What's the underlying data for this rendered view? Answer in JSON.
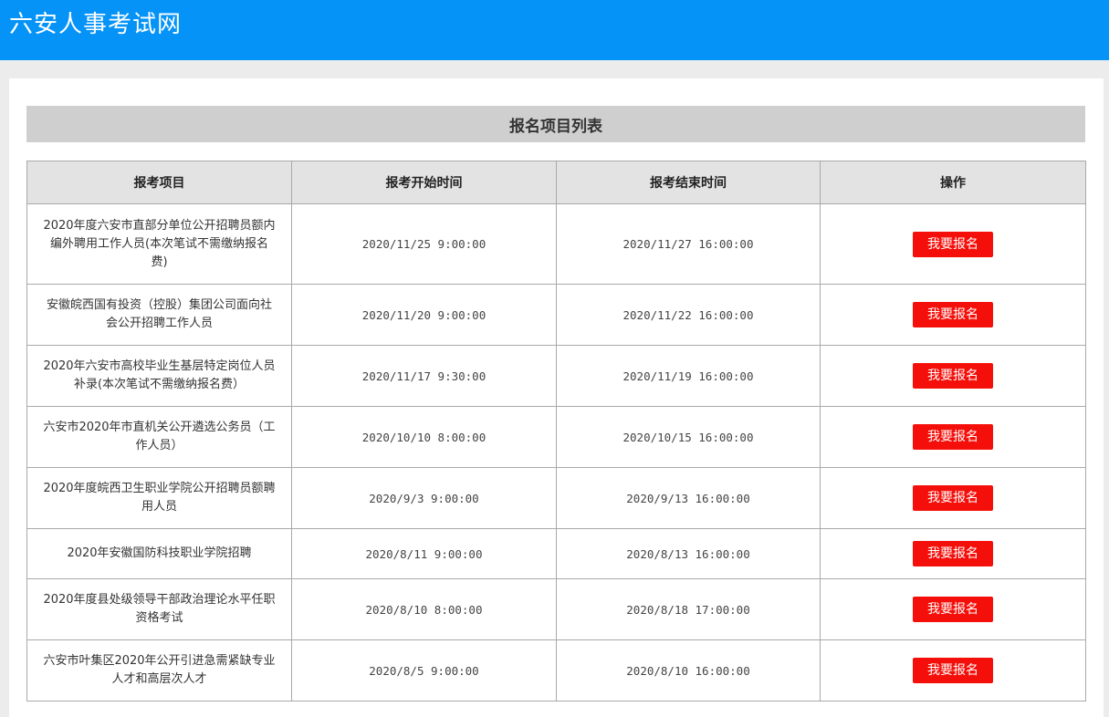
{
  "header": {
    "title": "六安人事考试网"
  },
  "list": {
    "title": "报名项目列表",
    "columns": [
      "报考项目",
      "报考开始时间",
      "报考结束时间",
      "操作"
    ],
    "rows": [
      {
        "project": "2020年度六安市直部分单位公开招聘员额内编外聘用工作人员(本次笔试不需缴纳报名费)",
        "start": "2020/11/25 9:00:00",
        "end": "2020/11/27 16:00:00",
        "action": "我要报名"
      },
      {
        "project": "安徽皖西国有投资（控股）集团公司面向社会公开招聘工作人员",
        "start": "2020/11/20 9:00:00",
        "end": "2020/11/22 16:00:00",
        "action": "我要报名"
      },
      {
        "project": "2020年六安市高校毕业生基层特定岗位人员补录(本次笔试不需缴纳报名费）",
        "start": "2020/11/17 9:30:00",
        "end": "2020/11/19 16:00:00",
        "action": "我要报名"
      },
      {
        "project": "六安市2020年市直机关公开遴选公务员（工作人员）",
        "start": "2020/10/10 8:00:00",
        "end": "2020/10/15 16:00:00",
        "action": "我要报名"
      },
      {
        "project": "2020年度皖西卫生职业学院公开招聘员额聘用人员",
        "start": "2020/9/3 9:00:00",
        "end": "2020/9/13 16:00:00",
        "action": "我要报名"
      },
      {
        "project": "2020年安徽国防科技职业学院招聘",
        "start": "2020/8/11 9:00:00",
        "end": "2020/8/13 16:00:00",
        "action": "我要报名"
      },
      {
        "project": "2020年度县处级领导干部政治理论水平任职资格考试",
        "start": "2020/8/10 8:00:00",
        "end": "2020/8/18 17:00:00",
        "action": "我要报名"
      },
      {
        "project": "六安市叶集区2020年公开引进急需紧缺专业人才和高层次人才",
        "start": "2020/8/5 9:00:00",
        "end": "2020/8/10 16:00:00",
        "action": "我要报名"
      }
    ]
  }
}
